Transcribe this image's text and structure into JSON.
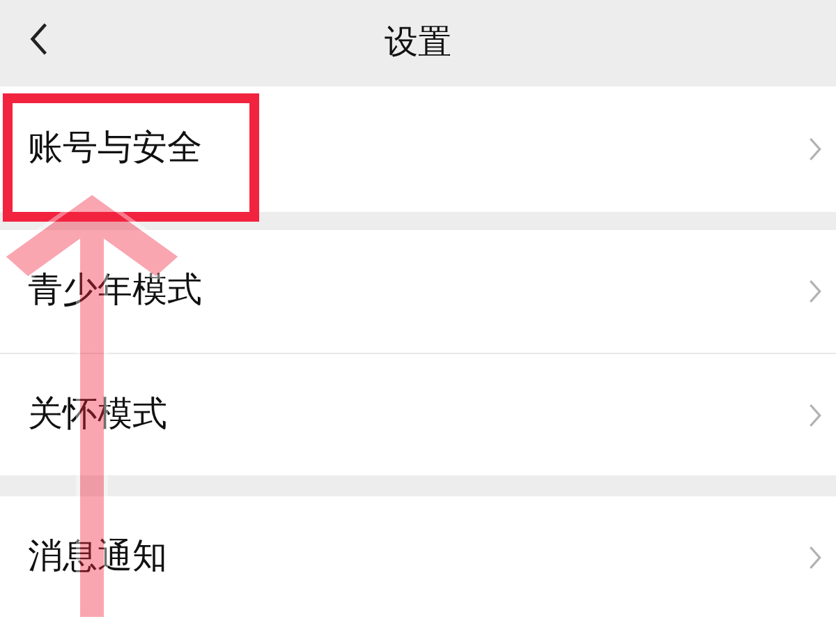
{
  "header": {
    "title": "设置"
  },
  "sections": [
    {
      "items": [
        {
          "label": "账号与安全"
        }
      ]
    },
    {
      "items": [
        {
          "label": "青少年模式"
        },
        {
          "label": "关怀模式"
        }
      ]
    },
    {
      "items": [
        {
          "label": "消息通知"
        }
      ]
    }
  ]
}
